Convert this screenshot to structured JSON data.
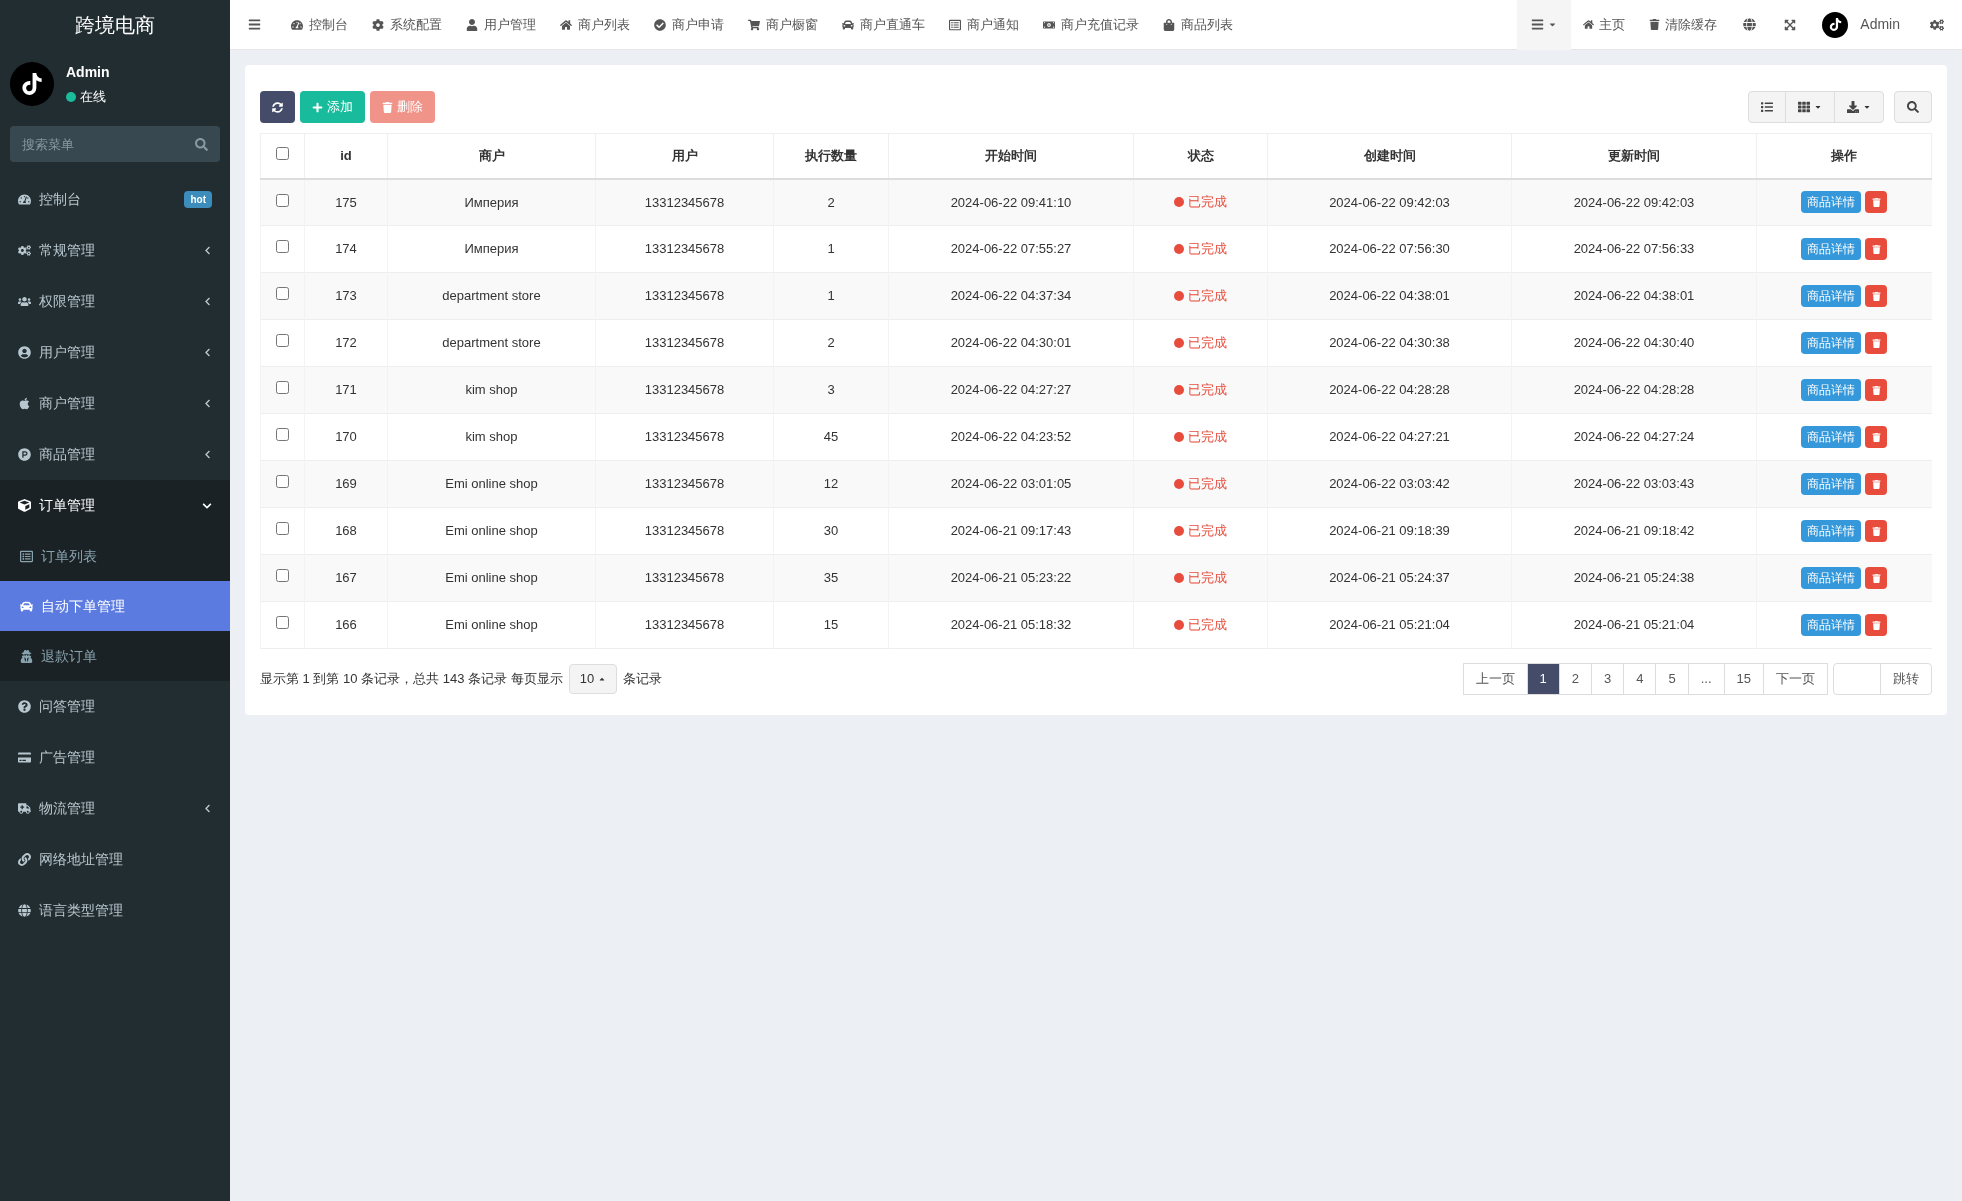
{
  "brand": "跨境电商",
  "user": {
    "name": "Admin",
    "status": "在线"
  },
  "sidebar": {
    "search": {
      "placeholder": "搜索菜单"
    },
    "items": [
      {
        "label": "控制台",
        "badge": "hot"
      },
      {
        "label": "常规管理",
        "expanded": false
      },
      {
        "label": "权限管理",
        "expanded": false
      },
      {
        "label": "用户管理",
        "expanded": false
      },
      {
        "label": "商户管理",
        "expanded": false
      },
      {
        "label": "商品管理",
        "expanded": false
      },
      {
        "label": "订单管理",
        "expanded": true,
        "children": [
          {
            "label": "订单列表",
            "selected": false
          },
          {
            "label": "自动下单管理",
            "selected": true
          },
          {
            "label": "退款订单",
            "selected": false
          }
        ]
      },
      {
        "label": "问答管理"
      },
      {
        "label": "广告管理"
      },
      {
        "label": "物流管理",
        "expanded": false
      },
      {
        "label": "网络地址管理"
      },
      {
        "label": "语言类型管理"
      }
    ]
  },
  "topnav": {
    "tabs": [
      "控制台",
      "系统配置",
      "用户管理",
      "商户列表",
      "商户申请",
      "商户橱窗",
      "商户直通车",
      "商户通知",
      "商户充值记录",
      "商品列表"
    ],
    "right": [
      "主页",
      "清除缓存"
    ],
    "user": "Admin"
  },
  "toolbar": {
    "buttons": [
      {
        "disabled": false
      },
      {
        "label": "添加",
        "disabled": false
      },
      {
        "label": "删除",
        "disabled": true
      }
    ]
  },
  "table": {
    "all_checked": false,
    "columns": [
      "id",
      "商户",
      "用户",
      "执行数量",
      "开始时间",
      "状态",
      "创建时间",
      "更新时间",
      "操作"
    ],
    "rows": [
      {
        "checked": false,
        "cells": [
          "175",
          "Империя",
          "13312345678",
          "2",
          "2024-06-22 09:41:10",
          "已完成",
          "2024-06-22 09:42:03",
          "2024-06-22 09:42:03"
        ],
        "action": "商品详情"
      },
      {
        "checked": false,
        "cells": [
          "174",
          "Империя",
          "13312345678",
          "1",
          "2024-06-22 07:55:27",
          "已完成",
          "2024-06-22 07:56:30",
          "2024-06-22 07:56:33"
        ],
        "action": "商品详情"
      },
      {
        "checked": false,
        "cells": [
          "173",
          "department store",
          "13312345678",
          "1",
          "2024-06-22 04:37:34",
          "已完成",
          "2024-06-22 04:38:01",
          "2024-06-22 04:38:01"
        ],
        "action": "商品详情"
      },
      {
        "checked": false,
        "cells": [
          "172",
          "department store",
          "13312345678",
          "2",
          "2024-06-22 04:30:01",
          "已完成",
          "2024-06-22 04:30:38",
          "2024-06-22 04:30:40"
        ],
        "action": "商品详情"
      },
      {
        "checked": false,
        "cells": [
          "171",
          "kim shop",
          "13312345678",
          "3",
          "2024-06-22 04:27:27",
          "已完成",
          "2024-06-22 04:28:28",
          "2024-06-22 04:28:28"
        ],
        "action": "商品详情"
      },
      {
        "checked": false,
        "cells": [
          "170",
          "kim shop",
          "13312345678",
          "45",
          "2024-06-22 04:23:52",
          "已完成",
          "2024-06-22 04:27:21",
          "2024-06-22 04:27:24"
        ],
        "action": "商品详情"
      },
      {
        "checked": false,
        "cells": [
          "169",
          "Emi online shop",
          "13312345678",
          "12",
          "2024-06-22 03:01:05",
          "已完成",
          "2024-06-22 03:03:42",
          "2024-06-22 03:03:43"
        ],
        "action": "商品详情"
      },
      {
        "checked": false,
        "cells": [
          "168",
          "Emi online shop",
          "13312345678",
          "30",
          "2024-06-21 09:17:43",
          "已完成",
          "2024-06-21 09:18:39",
          "2024-06-21 09:18:42"
        ],
        "action": "商品详情"
      },
      {
        "checked": false,
        "cells": [
          "167",
          "Emi online shop",
          "13312345678",
          "35",
          "2024-06-21 05:23:22",
          "已完成",
          "2024-06-21 05:24:37",
          "2024-06-21 05:24:38"
        ],
        "action": "商品详情"
      },
      {
        "checked": false,
        "cells": [
          "166",
          "Emi online shop",
          "13312345678",
          "15",
          "2024-06-21 05:18:32",
          "已完成",
          "2024-06-21 05:21:04",
          "2024-06-21 05:21:04"
        ],
        "action": "商品详情"
      }
    ]
  },
  "footer": {
    "summary": "显示第 1 到第 10 条记录，总共 143 条记录 每页显示",
    "page_size": "10",
    "suffix": "条记录",
    "pages": [
      {
        "label": "上一页",
        "selected": false
      },
      {
        "label": "1",
        "selected": true
      },
      {
        "label": "2",
        "selected": false
      },
      {
        "label": "3",
        "selected": false
      },
      {
        "label": "4",
        "selected": false
      },
      {
        "label": "5",
        "selected": false
      },
      {
        "label": "...",
        "selected": false
      },
      {
        "label": "15",
        "selected": false
      },
      {
        "label": "下一页",
        "selected": false
      }
    ],
    "jump": "跳转"
  }
}
